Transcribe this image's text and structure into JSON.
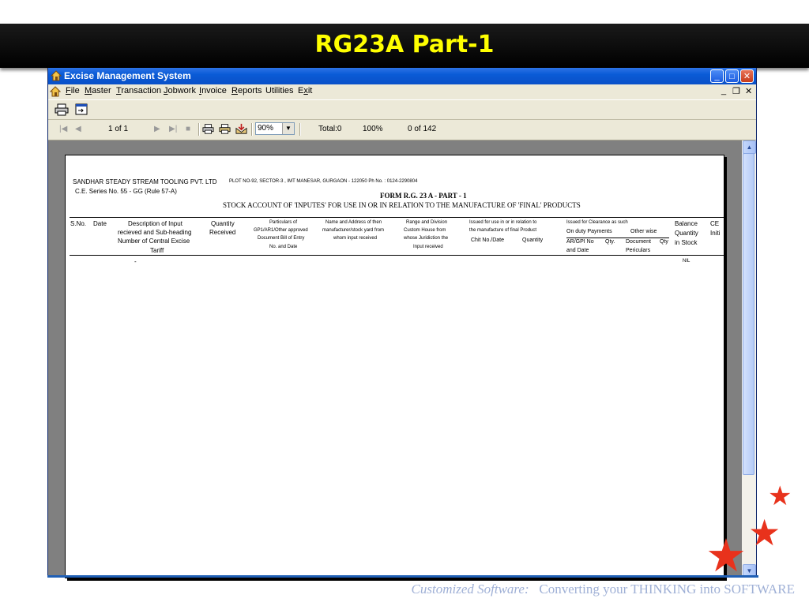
{
  "slide": {
    "title": "RG23A Part-1",
    "footer_italic": "Customized Software",
    "footer_colon": ":",
    "footer_rest": "Converting your THINKING into SOFTWARE"
  },
  "window": {
    "title": "Excise Management System",
    "minimize": "_",
    "maximize": "□",
    "close": "✕"
  },
  "menu": {
    "items": [
      {
        "key": "F",
        "rest": "ile"
      },
      {
        "key": "M",
        "rest": "aster"
      },
      {
        "key": "T",
        "rest": "ransaction"
      },
      {
        "key": "J",
        "rest": "obwork"
      },
      {
        "key": "I",
        "rest": "nvoice"
      },
      {
        "key": "R",
        "rest": "eports"
      },
      {
        "key": "",
        "rest": "Utilities"
      },
      {
        "key": "E",
        "pre": "",
        "rest": "xit",
        "mid": "x"
      }
    ],
    "mdi_min": "_",
    "mdi_restore": "❐",
    "mdi_close": "✕"
  },
  "viewer_toolbar": {
    "first": "|◀",
    "prev": "◀",
    "page": "1 of 1",
    "next": "▶",
    "last": "▶|",
    "stop": "■",
    "zoom": "90%",
    "total": "Total:0",
    "percent": "100%",
    "records": "0 of 142"
  },
  "report": {
    "company": "SANDHAR STEADY STREAM TOOLING PVT. LTD",
    "address": "PLOT NO-92, SECTOR-3 , IMT MANESAR, GURGAON - 122050  Ph No. : 0124-2290804",
    "series": "C.E. Series No. 55 - GG  (Rule 57-A)",
    "form_title": "FORM R.G. 23 A - PART - 1",
    "subtitle": "STOCK ACCOUNT OF 'INPUTES' FOR USE IN OR IN RELATION TO THE MANUFACTURE OF 'FINAL' PRODUCTS",
    "col_sno": "S.No.",
    "col_date": "Date",
    "col_desc": [
      "Description of Input",
      "recieved and Sub-heading",
      "Number of Central Excise",
      "Tariff"
    ],
    "col_qty": [
      "Quantity",
      "Received"
    ],
    "col_particulars": [
      "Particulars of",
      "GP1/AR1/Other approved",
      "Document Bill of Entry",
      "No. and Date"
    ],
    "col_name": [
      "Name and Address of then",
      "manufacturer/stock yard from",
      "whom input received"
    ],
    "col_range": [
      "Range and Division",
      "Custom House from",
      "whose Juridiction the",
      "Input received"
    ],
    "col_issued_use": [
      "Issued for use in or in relation to",
      "the manufacture of final Product"
    ],
    "col_chit": "Chit No./Date",
    "col_quantity": "Quantity",
    "col_issued_clear": "Issued for Clearance  as such",
    "col_duty": "On duty Payments",
    "col_otherwise": "Other wise",
    "col_ar": [
      "AR/GPI No",
      "and Date"
    ],
    "col_qty2": "Qty.",
    "col_doc": [
      "Document",
      "Periculars"
    ],
    "col_qty3": "Qty",
    "col_balance": [
      "Balance",
      "Quantity",
      "in Stock"
    ],
    "col_ce": [
      "CE",
      "Initi"
    ],
    "row_dot": "-",
    "row_nil": "NIL"
  },
  "icons": {
    "app": "house-key-icon",
    "print": "printer-icon",
    "export": "export-icon"
  }
}
